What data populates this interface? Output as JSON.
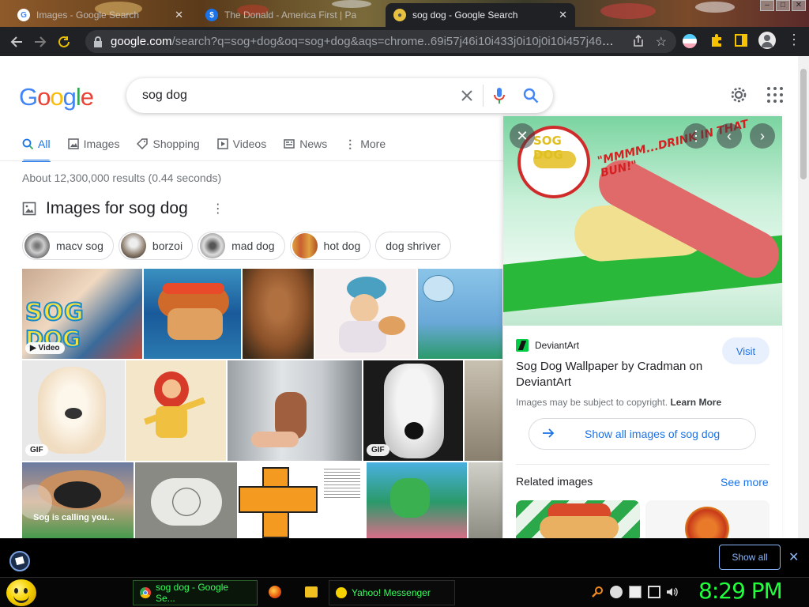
{
  "browser": {
    "tabs": [
      {
        "title": "Images - Google Search",
        "icon": "google-icon",
        "active": false
      },
      {
        "title": "The Donald - America First | Pa",
        "icon": "thedonald-icon",
        "active": false
      },
      {
        "title": "sog dog - Google Search",
        "icon": "google-icon",
        "active": true
      }
    ],
    "url_host": "google.com",
    "url_rest": "/search?q=sog+dog&oq=sog+dog&aqs=chrome..69i57j46i10i433j0i10j0i10i457j46i10i17...",
    "accent": "#202124"
  },
  "search": {
    "logo": "Google",
    "query": "sog dog",
    "tabs": [
      {
        "label": "All",
        "icon": "search-icon",
        "active": true
      },
      {
        "label": "Images",
        "icon": "image-icon"
      },
      {
        "label": "Shopping",
        "icon": "tag-icon"
      },
      {
        "label": "Videos",
        "icon": "play-icon"
      },
      {
        "label": "News",
        "icon": "news-icon"
      },
      {
        "label": "More",
        "icon": "more-vert-icon"
      }
    ],
    "stats": "About 12,300,000 results (0.44 seconds)",
    "images_header": "Images for sog dog",
    "chips": [
      "macv sog",
      "borzoi",
      "mad dog",
      "hot dog",
      "dog shriver"
    ],
    "badges": {
      "video": "Video",
      "gif": "GIF",
      "gif2": "GIF"
    },
    "image_caption": "Sog is calling you..."
  },
  "panel": {
    "image_text_logo": "SOG DOG",
    "image_text_caption": "\"MMMM...DRINK IN THAT BUN!\"",
    "source": "DeviantArt",
    "visit": "Visit",
    "title": "Sog Dog Wallpaper by Cradman on DeviantArt",
    "copyright": "Images may be subject to copyright.",
    "learn_more": "Learn More",
    "show_all": "Show all images of sog dog",
    "related_images": "Related images",
    "see_more": "See more"
  },
  "downloads": {
    "show_all": "Show all"
  },
  "taskbar": {
    "tasks": [
      {
        "label": "sog dog - Google Se..."
      },
      {
        "label": "Yahoo! Messenger"
      }
    ],
    "clock": "8:29 PM"
  }
}
